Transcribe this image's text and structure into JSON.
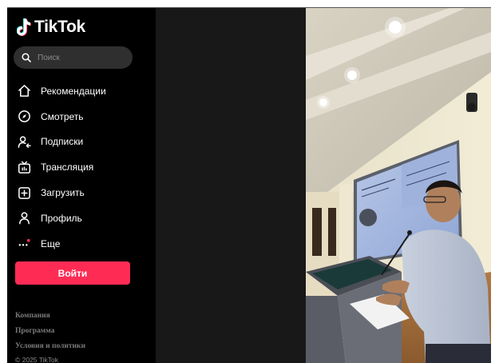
{
  "brand": {
    "name": "TikTok"
  },
  "search": {
    "placeholder": "Поиск"
  },
  "nav": {
    "items": [
      {
        "label": "Рекомендации",
        "icon": "home-icon"
      },
      {
        "label": "Смотреть",
        "icon": "compass-icon"
      },
      {
        "label": "Подписки",
        "icon": "following-icon"
      },
      {
        "label": "Трансляция",
        "icon": "live-icon"
      },
      {
        "label": "Загрузить",
        "icon": "upload-icon"
      },
      {
        "label": "Профиль",
        "icon": "profile-icon"
      },
      {
        "label": "Еще",
        "icon": "more-icon"
      }
    ]
  },
  "actions": {
    "login_label": "Войти"
  },
  "footer": {
    "links": [
      "Компания",
      "Программа",
      "Условия и политики"
    ],
    "copyright": "© 2025 TikTok"
  },
  "colors": {
    "accent": "#fe2c55",
    "background": "#000000",
    "panel": "#181818",
    "search_bg": "#2f2f2f"
  }
}
